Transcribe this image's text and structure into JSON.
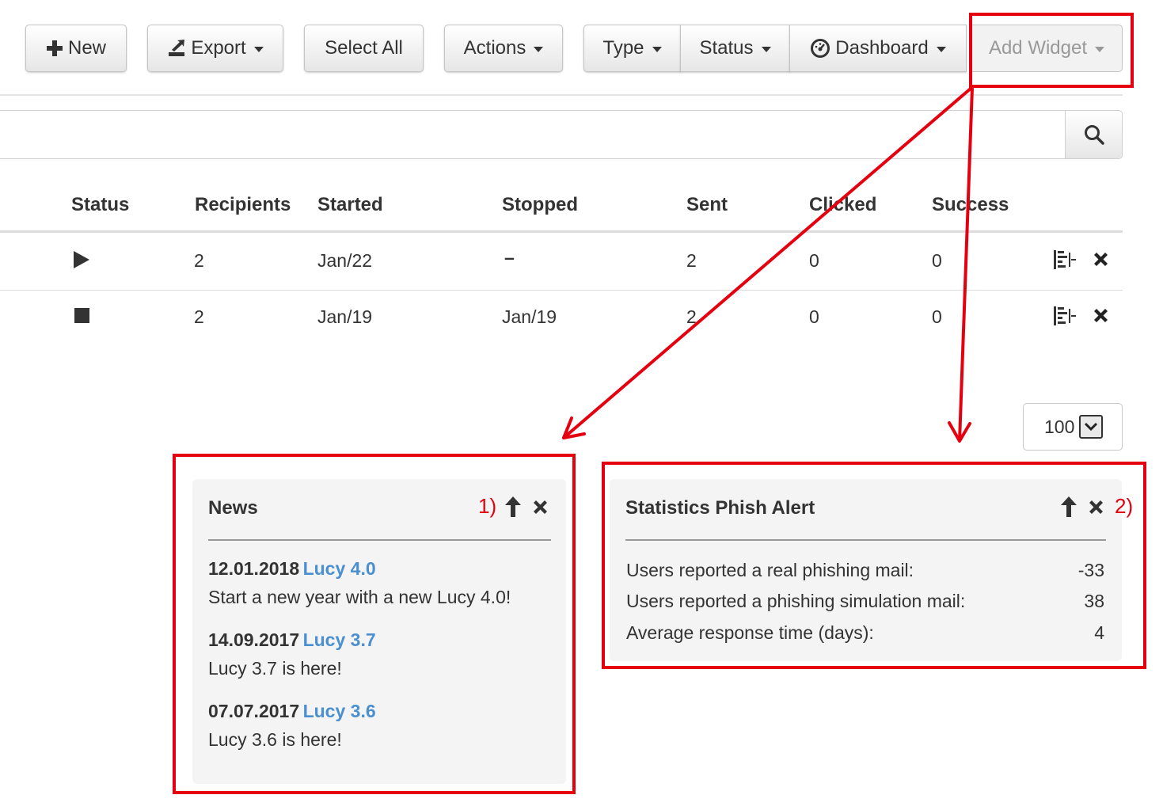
{
  "toolbar": {
    "new_label": "New",
    "export_label": "Export",
    "select_all_label": "Select All",
    "actions_label": "Actions",
    "type_label": "Type",
    "status_label": "Status",
    "dashboard_label": "Dashboard",
    "add_widget_label": "Add Widget"
  },
  "table": {
    "headers": [
      "Status",
      "Recipients",
      "Started",
      "Stopped",
      "Sent",
      "Clicked",
      "Success"
    ],
    "rows": [
      {
        "status_icon": "play-icon",
        "recipients": "2",
        "started": "Jan/22",
        "stopped": "–",
        "sent": "2",
        "clicked": "0",
        "success": "0"
      },
      {
        "status_icon": "stop-icon",
        "recipients": "2",
        "started": "Jan/19",
        "stopped": "Jan/19",
        "sent": "2",
        "clicked": "0",
        "success": "0"
      }
    ]
  },
  "pagination": {
    "page_size": "100"
  },
  "news_widget": {
    "title": "News",
    "annotation": "1)",
    "items": [
      {
        "date": "12.01.2018",
        "link": "Lucy 4.0",
        "text": "Start a new year with a new Lucy 4.0!"
      },
      {
        "date": "14.09.2017",
        "link": "Lucy 3.7",
        "text": "Lucy 3.7 is here!"
      },
      {
        "date": "07.07.2017",
        "link": "Lucy 3.6",
        "text": "Lucy 3.6 is here!"
      }
    ]
  },
  "stats_widget": {
    "title": "Statistics Phish Alert",
    "annotation": "2)",
    "rows": [
      {
        "label": "Users reported a real phishing mail:",
        "value": "-33"
      },
      {
        "label": "Users reported a phishing simulation mail:",
        "value": "38"
      },
      {
        "label": "Average response time (days):",
        "value": "4"
      }
    ]
  },
  "colors": {
    "annotation_red": "#e4000f",
    "link_blue": "#4a8fd0",
    "panel_bg": "#f4f4f4"
  }
}
